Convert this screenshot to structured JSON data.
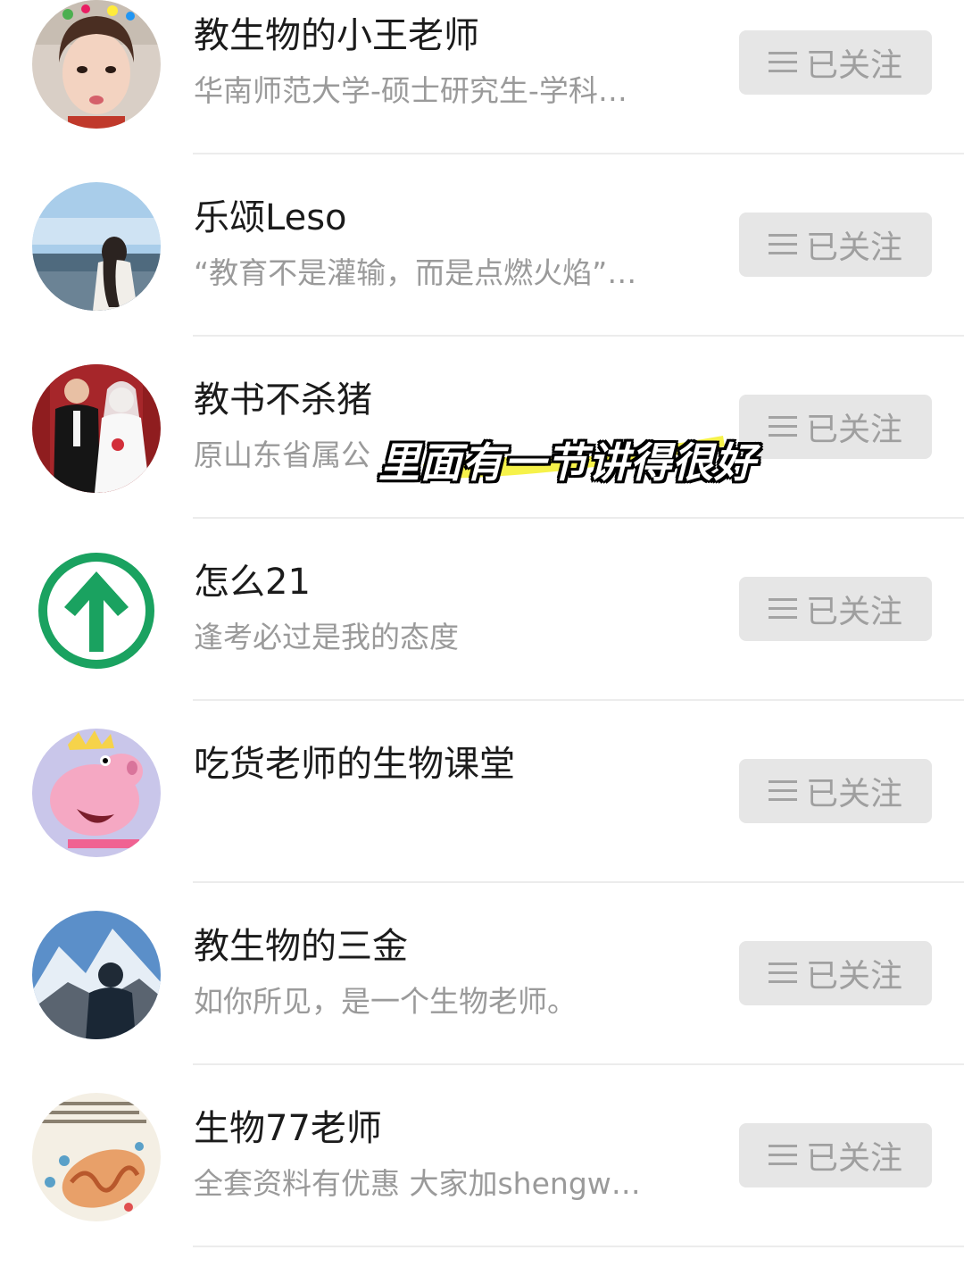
{
  "follow_list": [
    {
      "name": "教生物的小王老师",
      "desc": "华南师范大学-硕士研究生-学科…",
      "button": "已关注",
      "avatar": "teacher-portrait-avatar"
    },
    {
      "name": "乐颂Leso",
      "desc": "“教育不是灌输，而是点燃火焰”…",
      "button": "已关注",
      "avatar": "seaside-photo-avatar"
    },
    {
      "name": "教书不杀猪",
      "desc": "原山东省属公",
      "button": "已关注",
      "avatar": "wedding-photo-avatar"
    },
    {
      "name": "怎么21",
      "desc": "逢考必过是我的态度",
      "button": "已关注",
      "avatar": "green-up-arrow-avatar"
    },
    {
      "name": "吃货老师的生物课堂",
      "desc": "",
      "button": "已关注",
      "avatar": "cartoon-pig-avatar"
    },
    {
      "name": "教生物的三金",
      "desc": "如你所见，是一个生物老师。",
      "button": "已关注",
      "avatar": "mountain-photo-avatar"
    },
    {
      "name": "生物77老师",
      "desc": "全套资料有优惠 大家加shengw…",
      "button": "已关注",
      "avatar": "mitochondria-diagram-avatar"
    }
  ],
  "overlay_caption": "里面有一节讲得很好",
  "colors": {
    "button_bg": "#e6e6e6",
    "button_text": "#9f9f9f",
    "highlight": "#f5f02a",
    "arrow_green": "#1aa260"
  },
  "icons": {
    "button_icon": "menu-lines-icon"
  }
}
